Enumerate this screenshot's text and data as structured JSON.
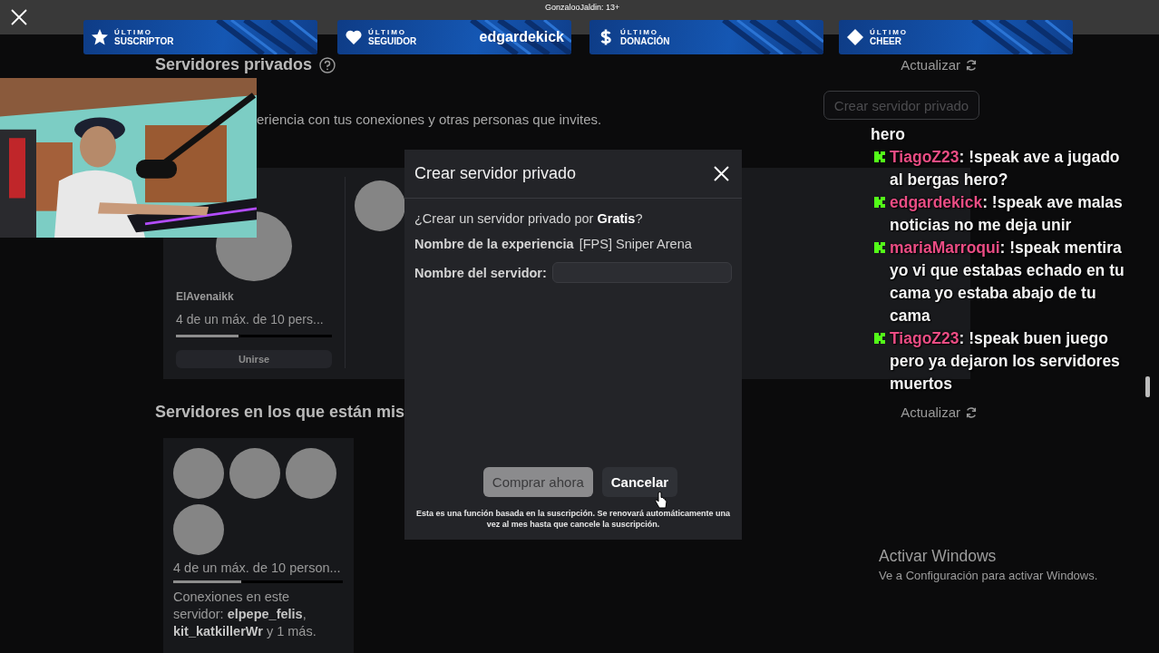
{
  "top_bar": {
    "stream_caption": "GonzalooJaldin: 13+"
  },
  "overlay_banners": [
    {
      "kind": "star",
      "heading": "ÚLTIMO",
      "label": "SUSCRIPTOR"
    },
    {
      "kind": "heart",
      "heading": "ÚLTIMO",
      "label": "SEGUIDOR",
      "value": "edgardekick"
    },
    {
      "kind": "dollar",
      "heading": "ÚLTIMO",
      "label": "DONACIÓN"
    },
    {
      "kind": "diamond",
      "heading": "ÚLTIMO",
      "label": "CHEER"
    }
  ],
  "private_servers": {
    "title": "Servidores privados",
    "refresh": "Actualizar",
    "description": "eriencia con tus conexiones y otras personas que invites.",
    "create_button": "Crear servidor privado",
    "servers": [
      {
        "avatars": [
          {
            "kind": "blank"
          }
        ],
        "name": "ElAvenaikk",
        "occupancy": "4 de un máx. de 10 pers...",
        "level": 0.4,
        "join": "Unirse"
      },
      {
        "avatars": [
          {
            "kind": "blank"
          }
        ]
      }
    ]
  },
  "friends_servers": {
    "title": "Servidores en los que están mis",
    "refresh": "Actualizar",
    "servers": [
      {
        "avatars": [
          {
            "kind": "blank"
          },
          {
            "kind": "blank"
          },
          {
            "kind": "blank"
          },
          {
            "kind": "blank"
          }
        ],
        "occupancy": "4 de un máx. de 10 person...",
        "level": 0.4,
        "connections": "Conexiones en este servidor: **elpepe_felis**, **kit_katkillerWr** y 1 más."
      }
    ]
  },
  "dialog": {
    "title": "Crear servidor privado",
    "question": "¿Crear un servidor privado por **Gratis**?",
    "experience_label": "Nombre de la experiencia",
    "experience_value": "[FPS] Sniper Arena",
    "server_name_label": "Nombre del servidor:",
    "buttons": [
      {
        "label": "Comprar ahora",
        "disabled": true
      },
      {
        "label": "Cancelar",
        "disabled": false
      }
    ],
    "footnote": "Esta es una función basada en la suscripción. Se renovará automáticamente una vez al mes hasta que cancele la suscripción."
  },
  "chat": [
    {
      "kind": "continuation",
      "text": "hero"
    },
    {
      "kind": "message",
      "user": "TiagoZ23",
      "text": ": !speak ave a jugado al bergas hero?"
    },
    {
      "kind": "message",
      "user": "edgardekick",
      "text": ": !speak ave malas noticias no me deja unir"
    },
    {
      "kind": "message",
      "user": "mariaMarroqui",
      "text": ": !speak mentira yo vi que estabas echado en tu cama yo estaba abajo de tu cama"
    },
    {
      "kind": "message",
      "user": "TiagoZ23",
      "text": ": !speak buen juego pero ya dejaron los servidores muertos"
    }
  ],
  "windows_activation_notice": {
    "title": "Activar Windows",
    "subtitle": "Ve a Configuración para activar Windows."
  }
}
